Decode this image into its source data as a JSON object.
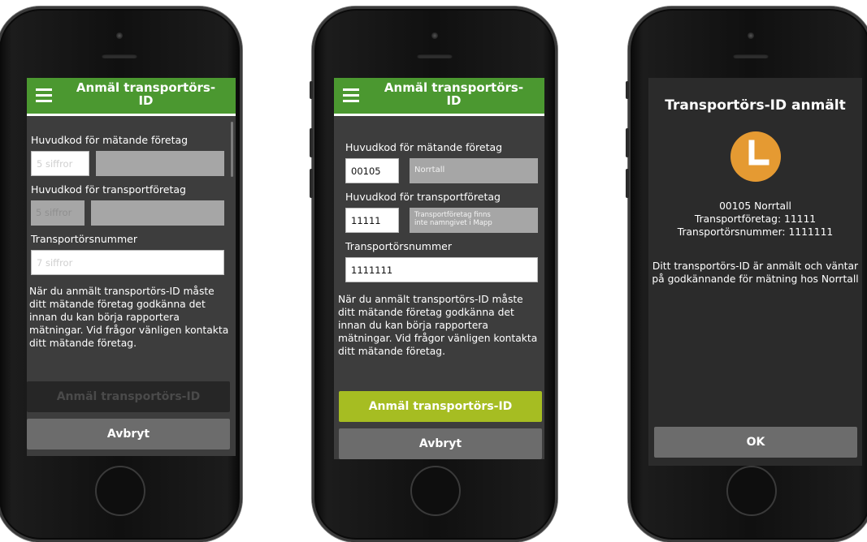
{
  "screen1": {
    "header_title": "Anmäl transportörs-\nID",
    "label_company_code": "Huvudkod för mätande företag",
    "company_code_placeholder": "5 siffror",
    "label_transport_code": "Huvudkod för transportföretag",
    "transport_code_placeholder": "5 siffror",
    "label_transporter_number": "Transportörsnummer",
    "transporter_number_placeholder": "7 siffror",
    "info": "När du anmält transportörs-ID måste ditt mätande företag godkänna det innan du kan börja rapportera mätningar. Vid frågor vänligen kontakta ditt mätande företag.",
    "submit_label": "Anmäl transportörs-ID",
    "cancel_label": "Avbryt"
  },
  "screen2": {
    "header_title": "Anmäl transportörs-\nID",
    "label_company_code": "Huvudkod för mätande företag",
    "company_code_value": "00105",
    "company_name": "Norrtall",
    "label_transport_code": "Huvudkod för transportföretag",
    "transport_code_value": "11111",
    "transport_company_note": "Transportföretag finns\ninte namngivet i Mapp",
    "label_transporter_number": "Transportörsnummer",
    "transporter_number_value": "1111111",
    "info": "När du anmält transportörs-ID måste ditt mätande företag godkänna det innan du kan börja rapportera mätningar. Vid frågor vänligen kontakta ditt mätande företag.",
    "submit_label": "Anmäl transportörs-ID",
    "cancel_label": "Avbryt"
  },
  "screen3": {
    "title": "Transportörs-ID anmält",
    "line1": "00105 Norrtall",
    "line2": "Transportföretag: 11111",
    "line3": "Transportörsnummer: 1111111",
    "message": "Ditt transportörs-ID är anmält och väntar på godkännande för mätning hos Norrtall",
    "ok_label": "OK"
  },
  "colors": {
    "header_green": "#4b9830",
    "submit_green": "#a6bd22",
    "clock_orange": "#e59a32",
    "button_grey": "#6c6c6c",
    "disabled_button": "#262626"
  },
  "icons": [
    "hamburger-menu-icon",
    "clock-icon"
  ]
}
